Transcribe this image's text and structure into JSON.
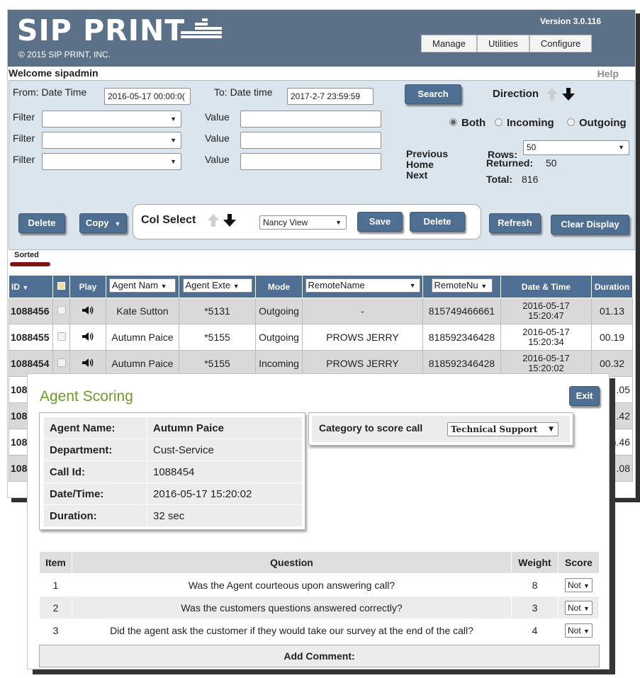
{
  "header": {
    "logo_text": "SIP PRINT",
    "copyright": "© 2015 SIP PRINT, INC.",
    "version": "Version 3.0.116",
    "menu": [
      "Manage",
      "Utilities",
      "Configure"
    ],
    "welcome": "Welcome sipadmin",
    "help": "Help"
  },
  "filters": {
    "from_label": "From: Date Time",
    "from_value": "2016-05-17 00:00:0(",
    "to_label": "To: Date time",
    "to_value": "2017-2-7 23:59:59",
    "search": "Search",
    "direction_label": "Direction",
    "filter_label": "Filter",
    "value_label": "Value",
    "dir_options": [
      "Both",
      "Incoming",
      "Outgoing"
    ],
    "dir_selected": "Both",
    "nav": [
      "Previous",
      "Home",
      "Next"
    ],
    "rows_label": "Rows:",
    "rows_value": "50",
    "returned_label": "Returned:",
    "returned_value": "50",
    "total_label": "Total:",
    "total_value": "816"
  },
  "toolbar": {
    "delete": "Delete",
    "copy": "Copy",
    "col_select": "Col Select",
    "view": "Nancy View",
    "save": "Save",
    "delete2": "Delete",
    "refresh": "Refresh",
    "clear": "Clear Display",
    "sorted": "Sorted"
  },
  "table": {
    "headers": {
      "id": "ID",
      "play": "Play",
      "agent_name": "Agent Nam",
      "agent_ext": "Agent Exte",
      "mode": "Mode",
      "remote_name": "RemoteName",
      "remote_num": "RemoteNu",
      "datetime": "Date & Time",
      "duration": "Duration"
    },
    "rows": [
      {
        "id": "1088456",
        "agent": "Kate Sutton",
        "ext": "*5131",
        "mode": "Outgoing",
        "remote": "-",
        "num": "815749466661",
        "date": "2016-05-17",
        "time": "15:20:47",
        "dur": "01.13"
      },
      {
        "id": "1088455",
        "agent": "Autumn Paice",
        "ext": "*5155",
        "mode": "Outgoing",
        "remote": "PROWS JERRY",
        "num": "818592346428",
        "date": "2016-05-17",
        "time": "15:20:34",
        "dur": "00.19"
      },
      {
        "id": "1088454",
        "agent": "Autumn Paice",
        "ext": "*5155",
        "mode": "Incoming",
        "remote": "PROWS JERRY",
        "num": "818592346428",
        "date": "2016-05-17",
        "time": "15:20:02",
        "dur": "00.32"
      }
    ],
    "partial_ids": [
      "108",
      "108",
      "108",
      "108"
    ],
    "partial_durs": [
      ".05",
      ".42",
      ").46",
      ".08"
    ]
  },
  "dialog": {
    "title": "Agent Scoring",
    "exit": "Exit",
    "info": [
      {
        "k": "Agent Name:",
        "v": "Autumn Paice"
      },
      {
        "k": "Department:",
        "v": "Cust-Service"
      },
      {
        "k": "Call Id:",
        "v": "1088454"
      },
      {
        "k": "Date/Time:",
        "v": "2016-05-17 15:20:02"
      },
      {
        "k": "Duration:",
        "v": "32 sec"
      }
    ],
    "category_label": "Category to score call",
    "category_value": "Technical Support",
    "q_headers": {
      "item": "Item",
      "question": "Question",
      "weight": "Weight",
      "score": "Score"
    },
    "questions": [
      {
        "item": "1",
        "q": "Was the Agent courteous upon answering call?",
        "w": "8",
        "s": "Not"
      },
      {
        "item": "2",
        "q": "Was the customers questions answered correctly?",
        "w": "3",
        "s": "Not"
      },
      {
        "item": "3",
        "q": "Did the agent ask the customer if they would take our survey at the end of the call?",
        "w": "4",
        "s": "Not"
      }
    ],
    "add_comment": "Add Comment:"
  }
}
